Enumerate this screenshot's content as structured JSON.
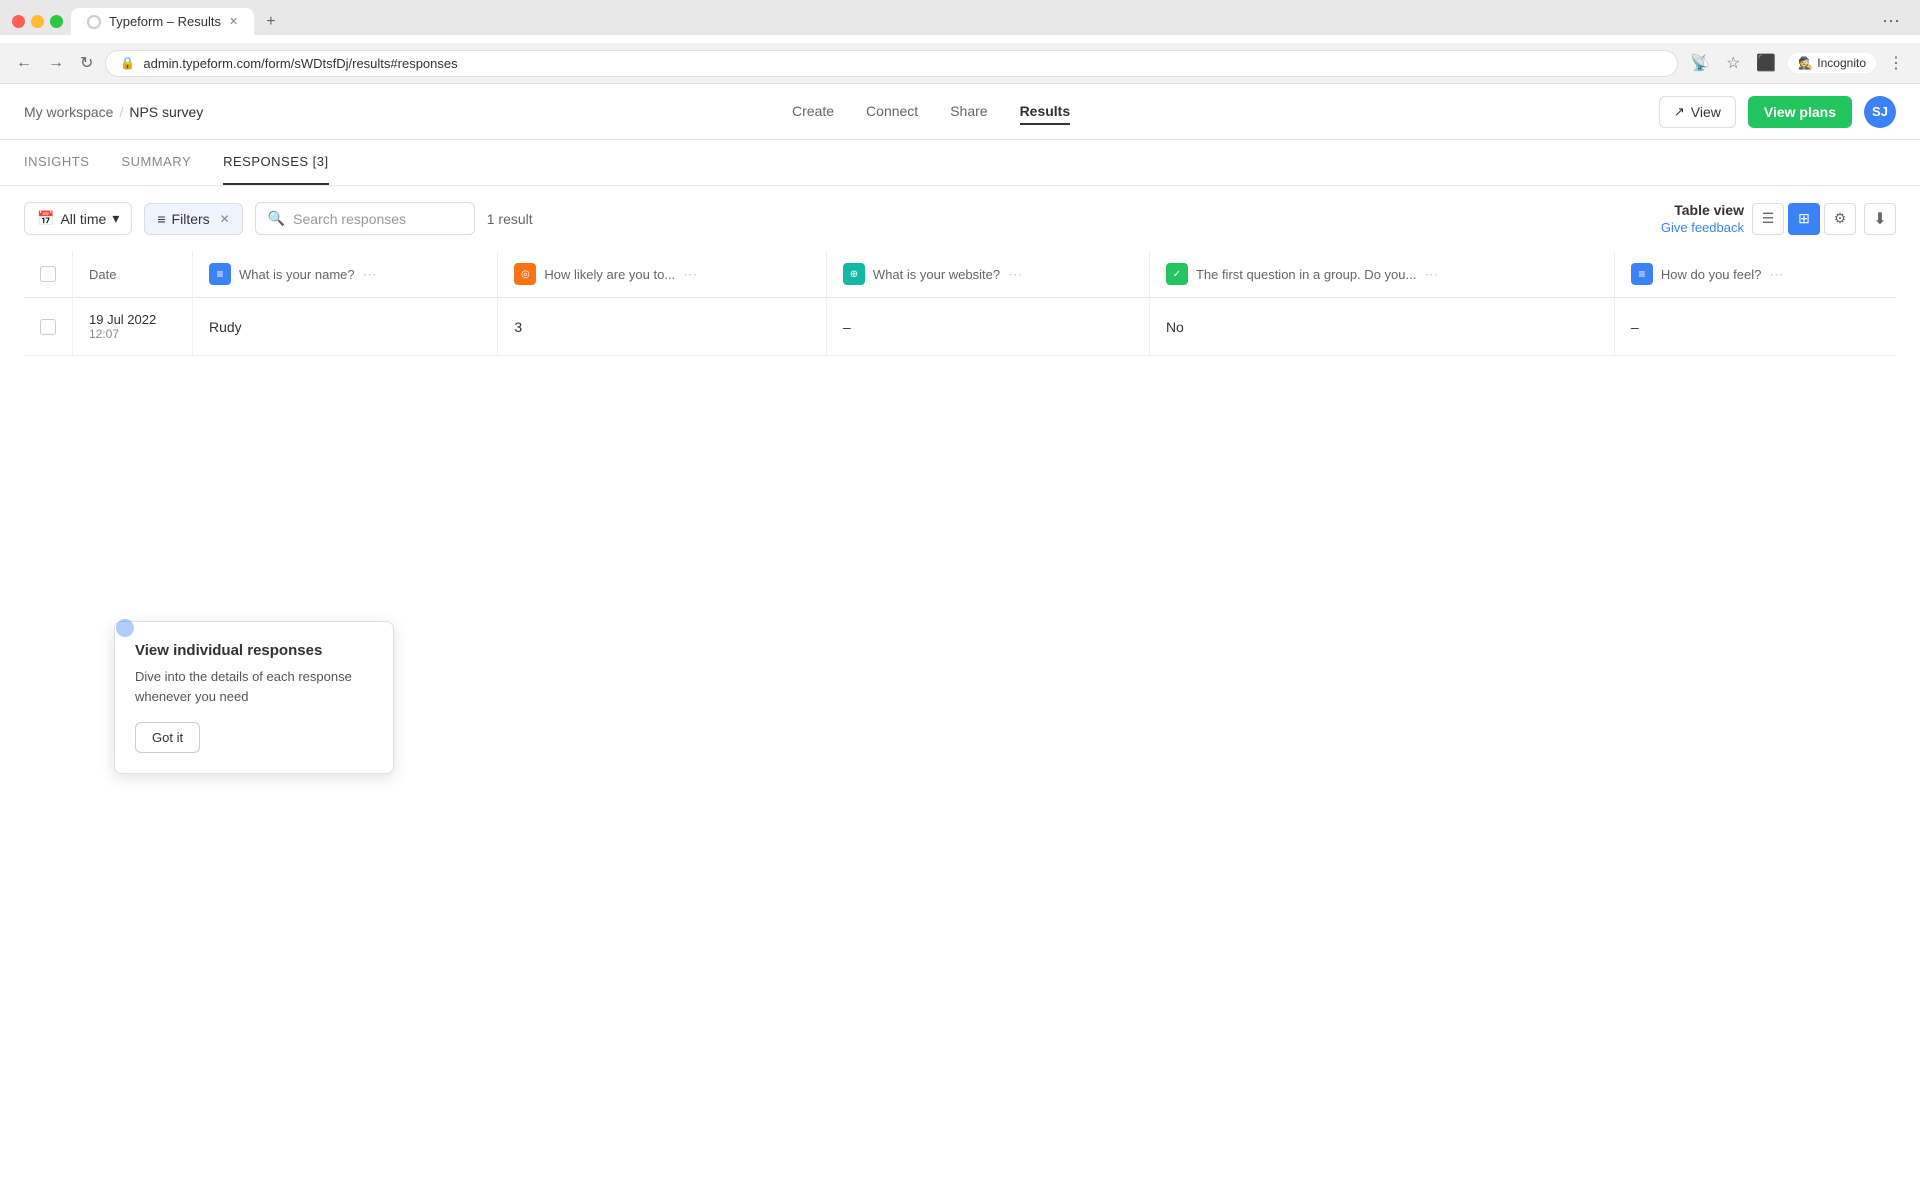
{
  "browser": {
    "tab_title": "Typeform – Results",
    "address": "admin.typeform.com/form/sWDtsfDj/results#responses",
    "incognito_label": "Incognito"
  },
  "nav": {
    "workspace": "My workspace",
    "separator": "/",
    "form_name": "NPS survey",
    "links": [
      "Create",
      "Connect",
      "Share",
      "Results"
    ],
    "active_link": "Results",
    "view_btn": "View",
    "view_plans_btn": "View plans",
    "avatar_initials": "SJ"
  },
  "sub_nav": {
    "items": [
      "INSIGHTS",
      "SUMMARY",
      "RESPONSES [3]"
    ],
    "active": "RESPONSES [3]"
  },
  "toolbar": {
    "date_filter": "All time",
    "filters_label": "Filters",
    "search_placeholder": "Search responses",
    "result_count": "1 result",
    "table_view_label": "Table view",
    "give_feedback": "Give feedback"
  },
  "table": {
    "columns": [
      {
        "id": "date",
        "label": "Date"
      },
      {
        "id": "name",
        "label": "What is your name?",
        "icon": "blue",
        "icon_char": "≡"
      },
      {
        "id": "likely",
        "label": "How likely are you to...",
        "icon": "orange",
        "icon_char": "◎"
      },
      {
        "id": "website",
        "label": "What is your website?",
        "icon": "teal",
        "icon_char": "⊕"
      },
      {
        "id": "group_q",
        "label": "The first question in a group. Do you...",
        "icon": "green",
        "icon_char": "✓"
      },
      {
        "id": "feel",
        "label": "How do you feel?",
        "icon": "purple",
        "icon_char": "≡"
      }
    ],
    "rows": [
      {
        "date": "19 Jul 2022",
        "time": "12:07",
        "name": "Rudy",
        "likely": "3",
        "website": "–",
        "group_q": "No",
        "feel": "–"
      }
    ]
  },
  "tooltip": {
    "title": "View individual responses",
    "description": "Dive into the details of each response whenever you need",
    "button": "Got it"
  }
}
